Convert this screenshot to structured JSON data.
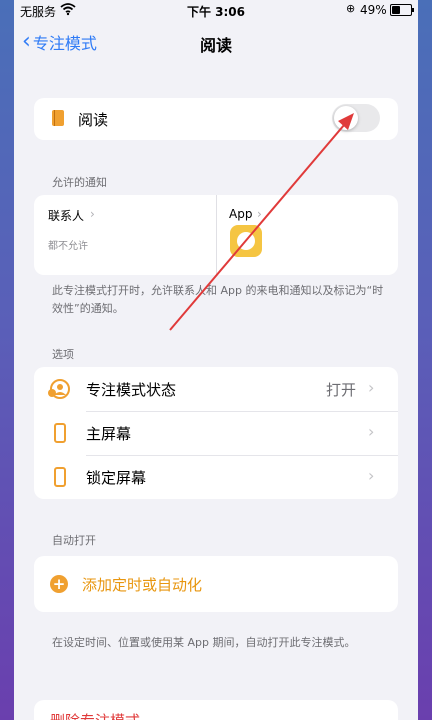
{
  "status": {
    "carrier": "无服务",
    "time": "下午 3:06",
    "battery": "49%"
  },
  "nav": {
    "back_label": "专注模式",
    "title": "阅读"
  },
  "focus": {
    "label": "阅读",
    "toggle_on": false
  },
  "notifications": {
    "section_label": "允许的通知",
    "people_label": "联系人",
    "people_sub": "都不允许",
    "apps_label": "App",
    "footer": "此专注模式打开时，允许联系人和 App 的来电和通知以及标记为“时效性”的通知。"
  },
  "options": {
    "section_label": "选项",
    "items": [
      {
        "label": "专注模式状态",
        "value": "打开"
      },
      {
        "label": "主屏幕",
        "value": ""
      },
      {
        "label": "锁定屏幕",
        "value": ""
      }
    ]
  },
  "auto": {
    "section_label": "自动打开",
    "add_label": "添加定时或自动化",
    "footer": "在设定时间、位置或使用某 App 期间，自动打开此专注模式。"
  },
  "delete": {
    "label": "删除专注模式"
  },
  "colors": {
    "accent_blue": "#2f7bf6",
    "accent_orange": "#f0a030",
    "annotation_red": "#e03a3a"
  },
  "icons": [
    "wifi-icon",
    "lock-rotation-icon",
    "battery-icon",
    "book-icon",
    "app-icon",
    "focus-status-icon",
    "home-screen-icon",
    "lock-screen-icon",
    "add-icon",
    "chevron-right-icon"
  ]
}
